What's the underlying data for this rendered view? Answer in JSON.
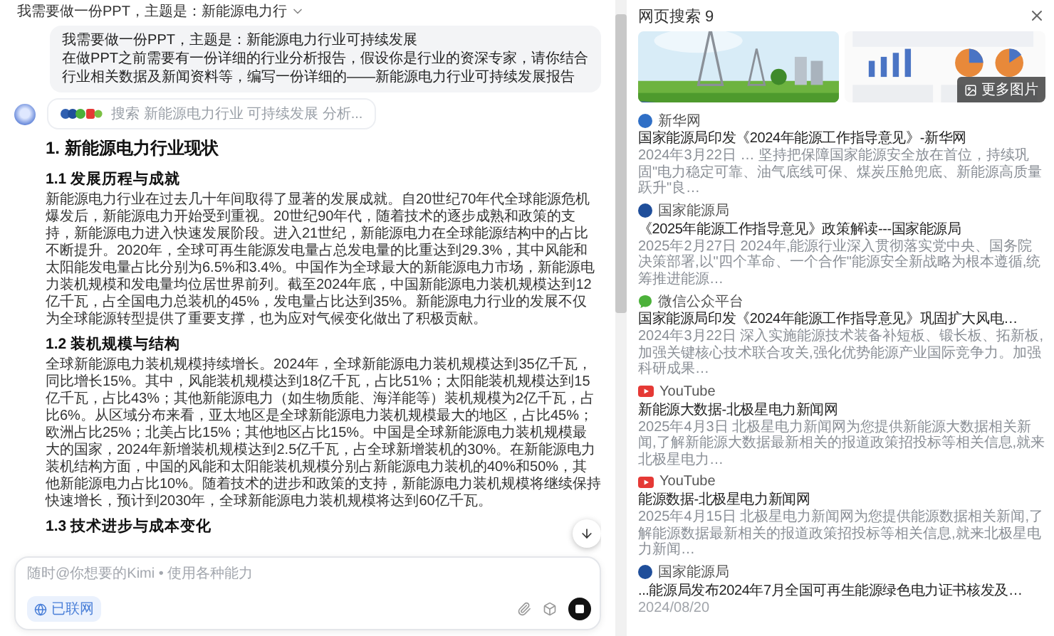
{
  "header": {
    "title": "我需要做一份PPT，主题是：新能源电力行"
  },
  "user_message": {
    "lines": [
      "我需要做一份PPT，主题是：新能源电力行业可持续发展",
      "在做PPT之前需要有一份详细的行业分析报告，假设你是行业的资深专家，请你结合",
      "行业相关数据及新闻资料等，编写一份详细的——新能源电力行业可持续发展报告"
    ]
  },
  "assistant": {
    "search_summary": "搜索 新能源电力行业 可持续发展 分析...",
    "sections": [
      {
        "kind": "h1",
        "text": "1. 新能源电力行业现状"
      },
      {
        "kind": "h2",
        "text": "1.1 发展历程与成就"
      },
      {
        "kind": "p",
        "text": "新能源电力行业在过去几十年间取得了显著的发展成就。自20世纪70年代全球能源危机爆发后，新能源电力开始受到重视。20世纪90年代，随着技术的逐步成熟和政策的支持，新能源电力进入快速发展阶段。进入21世纪，新能源电力在全球能源结构中的占比不断提升。2020年，全球可再生能源发电量占总发电量的比重达到29.3%，其中风能和太阳能发电量占比分别为6.5%和3.4%。中国作为全球最大的新能源电力市场，新能源电力装机规模和发电量均位居世界前列。截至2024年底，中国新能源电力装机规模达到12亿千瓦，占全国电力总装机的45%，发电量占比达到35%。新能源电力行业的发展不仅为全球能源转型提供了重要支撑，也为应对气候变化做出了积极贡献。"
      },
      {
        "kind": "h2",
        "text": "1.2 装机规模与结构"
      },
      {
        "kind": "p",
        "text": "全球新能源电力装机规模持续增长。2024年，全球新能源电力装机规模达到35亿千瓦，同比增长15%。其中，风能装机规模达到18亿千瓦，占比51%；太阳能装机规模达到15亿千瓦，占比43%；其他新能源电力（如生物质能、海洋能等）装机规模为2亿千瓦，占比6%。从区域分布来看，亚太地区是全球新能源电力装机规模最大的地区，占比45%；欧洲占比25%；北美占比15%；其他地区占比15%。中国是全球新能源电力装机规模最大的国家，2024年新增装机规模达到2.5亿千瓦，占全球新增装机的30%。在新能源电力装机结构方面，中国的风能和太阳能装机规模分别占新能源电力装机的40%和50%，其他新能源电力占比10%。随着技术的进步和政策的支持，新能源电力装机规模将继续保持快速增长，预计到2030年，全球新能源电力装机规模将达到60亿千瓦。"
      },
      {
        "kind": "h2",
        "text": "1.3 技术进步与成本变化"
      }
    ]
  },
  "composer": {
    "placeholder": "随时@你想要的Kimi • 使用各种能力",
    "web_chip": "已联网"
  },
  "search_panel": {
    "title": "网页搜索 9",
    "more_images": "更多图片",
    "results": [
      {
        "source": "新华网",
        "kind": "round",
        "color": "#2f6fc6",
        "title": "国家能源局印发《2024年能源工作指导意见》-新华网",
        "snippet": "2024年3月22日 … 坚持把保障国家能源安全放在首位，持续巩固\"电力稳定可靠、油气底线可保、煤炭压舱兜底、新能源高质量跃升\"良…"
      },
      {
        "source": "国家能源局",
        "kind": "round",
        "color": "#1f4e9a",
        "title": "《2025年能源工作指导意见》政策解读---国家能源局",
        "snippet": "2025年2月27日 2024年,能源行业深入贯彻落实党中央、国务院决策部署,以\"四个革命、一个合作\"能源安全新战略为根本遵循,统筹推进能源…"
      },
      {
        "source": "微信公众平台",
        "kind": "chat",
        "color": "#4cb13a",
        "title": "国家能源局印发《2024年能源工作指导意见》巩固扩大风电…",
        "snippet": "2024年3月22日 深入实施能源技术装备补短板、锻长板、拓新板,加强关键核心技术联合攻关,强化优势能源产业国际竞争力。加强科研成果…"
      },
      {
        "source": "YouTube",
        "kind": "video",
        "color": "#e53935",
        "title": "新能源大数据-北极星电力新闻网",
        "snippet": "2025年4月3日 北极星电力新闻网为您提供新能源大数据相关新闻,了解新能源大数据最新相关的报道政策招投标等相关信息,就来北极星电力…"
      },
      {
        "source": "YouTube",
        "kind": "video",
        "color": "#e53935",
        "title": "能源数据-北极星电力新闻网",
        "snippet": "2025年4月15日 北极星电力新闻网为您提供能源数据相关新闻,了解能源数据最新相关的报道政策招投标等相关信息,就来北极星电力新闻…"
      },
      {
        "source": "国家能源局",
        "kind": "round",
        "color": "#1f4e9a",
        "title": "...能源局发布2024年7月全国可再生能源绿色电力证书核发及…",
        "date": "2024/08/20"
      }
    ]
  }
}
